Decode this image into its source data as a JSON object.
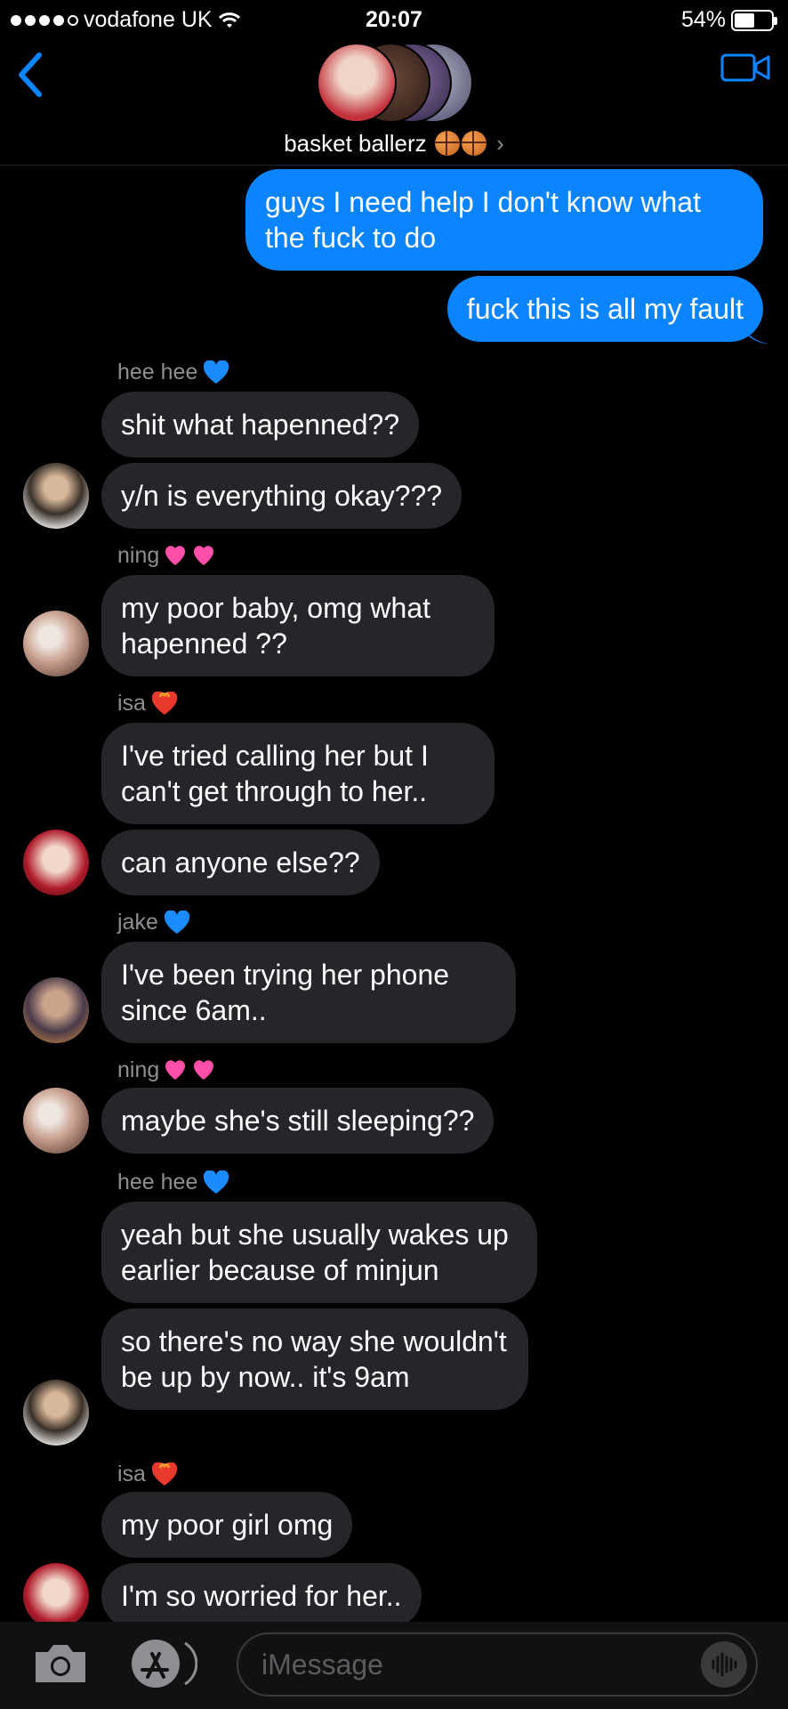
{
  "status": {
    "carrier": "vodafone UK",
    "time": "20:07",
    "battery": "54%",
    "battery_level": 0.54
  },
  "header": {
    "group_name": "basket ballerz",
    "emoji": [
      "basketball",
      "basketball"
    ],
    "back_icon": "chevron-left-icon",
    "video_icon": "video-camera-icon"
  },
  "colors": {
    "sent": "#0a84ff",
    "received": "#26262a",
    "accent": "#0a84ff",
    "background": "#000000"
  },
  "messages": [
    {
      "type": "sent",
      "text": "guys I need help I don't know what the fuck to do"
    },
    {
      "type": "sent",
      "text": "fuck this is all my fault"
    },
    {
      "type": "sender",
      "name": "hee hee",
      "emoji": "blue-heart"
    },
    {
      "type": "recv",
      "text": "shit what hapenned??"
    },
    {
      "type": "recv",
      "text": "y/n is everything okay???"
    },
    {
      "type": "sender",
      "name": "ning",
      "emoji": "two-hearts"
    },
    {
      "type": "recv",
      "text": "my poor baby, omg what hapenned ??"
    },
    {
      "type": "sender",
      "name": "isa",
      "emoji": "heart-on-fire"
    },
    {
      "type": "recv",
      "text": "I've tried calling her but I can't get through to her.."
    },
    {
      "type": "recv",
      "text": "can anyone else??"
    },
    {
      "type": "sender",
      "name": "jake",
      "emoji": "blue-heart"
    },
    {
      "type": "recv",
      "text": "I've been trying her phone since 6am.."
    },
    {
      "type": "sender",
      "name": "ning",
      "emoji": "two-hearts"
    },
    {
      "type": "recv",
      "text": "maybe she's still sleeping??"
    },
    {
      "type": "sender",
      "name": "hee hee",
      "emoji": "blue-heart"
    },
    {
      "type": "recv",
      "text": "yeah but she usually wakes up earlier because of minjun"
    },
    {
      "type": "recv",
      "text": "so there's no way she wouldn't be up by now.. it's 9am"
    },
    {
      "type": "sender",
      "name": "isa",
      "emoji": "heart-on-fire"
    },
    {
      "type": "recv",
      "text": "my poor girl omg"
    },
    {
      "type": "recv",
      "text": "I'm so worried for her.."
    }
  ],
  "input": {
    "placeholder": "iMessage",
    "camera_icon": "camera-icon",
    "apps_icon": "app-store-icon",
    "audio_icon": "audio-waveform-icon"
  }
}
